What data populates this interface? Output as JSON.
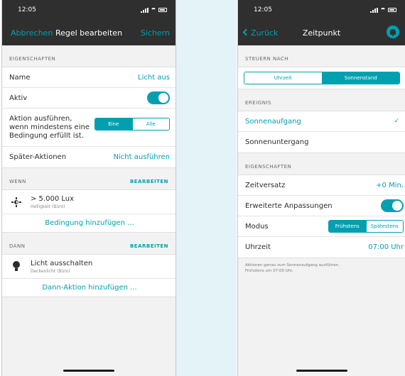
{
  "left_screen": {
    "status_time": "12:05",
    "nav": {
      "left": "Abbrechen",
      "title": "Regel bearbeiten",
      "right": "Sichern"
    },
    "properties": {
      "header": "EIGENSCHAFTEN",
      "name_label": "Name",
      "name_value": "Licht aus",
      "active_label": "Aktiv",
      "active_on": true,
      "rule_line1": "Aktion ausführen,",
      "rule_line2": "wenn mindestens eine",
      "rule_line3": "Bedingung erfüllt ist.",
      "rule_options": [
        "Eine",
        "Alle"
      ],
      "rule_selected": "Eine",
      "later_label": "Später-Aktionen",
      "later_value": "Nicht ausführen"
    },
    "wenn": {
      "header": "WENN",
      "edit": "BEARBEITEN",
      "condition_main": "> 5.000 Lux",
      "condition_sub": "Helligkeit (Büro)",
      "add": "Bedingung hinzufügen ..."
    },
    "dann": {
      "header": "DANN",
      "edit": "BEARBEITEN",
      "action_main": "Licht ausschalten",
      "action_sub": "Deckenlicht (Büro)",
      "add": "Dann-Aktion hinzufügen ..."
    }
  },
  "right_screen": {
    "status_time": "12:05",
    "nav": {
      "left": "Zurück",
      "title": "Zeitpunkt"
    },
    "steuern": {
      "header": "STEUERN NACH",
      "options": [
        "Uhrzeit",
        "Sonnenstand"
      ],
      "selected": "Sonnenstand"
    },
    "ereignis": {
      "header": "EREIGNIS",
      "items": [
        {
          "label": "Sonnenaufgang",
          "selected": true
        },
        {
          "label": "Sonnenuntergang",
          "selected": false
        }
      ]
    },
    "properties": {
      "header": "EIGENSCHAFTEN",
      "offset_label": "Zeitversatz",
      "offset_value": "+0 Min.",
      "extended_label": "Erweiterte Anpassungen",
      "extended_on": true,
      "mode_label": "Modus",
      "mode_options": [
        "Frühstens",
        "Spätestens"
      ],
      "mode_selected": "Frühstens",
      "time_label": "Uhrzeit",
      "time_value": "07:00 Uhr"
    },
    "footnote_line1": "Aktionen genau zum Sonnenaufgang ausführen.",
    "footnote_line2": "Frühstens um 07:00 Uhr."
  },
  "colors": {
    "accent": "#00a0b0",
    "bar": "#2f2f2f",
    "content_bg": "#f2f2f2",
    "side_band": "#e3f3f7"
  }
}
